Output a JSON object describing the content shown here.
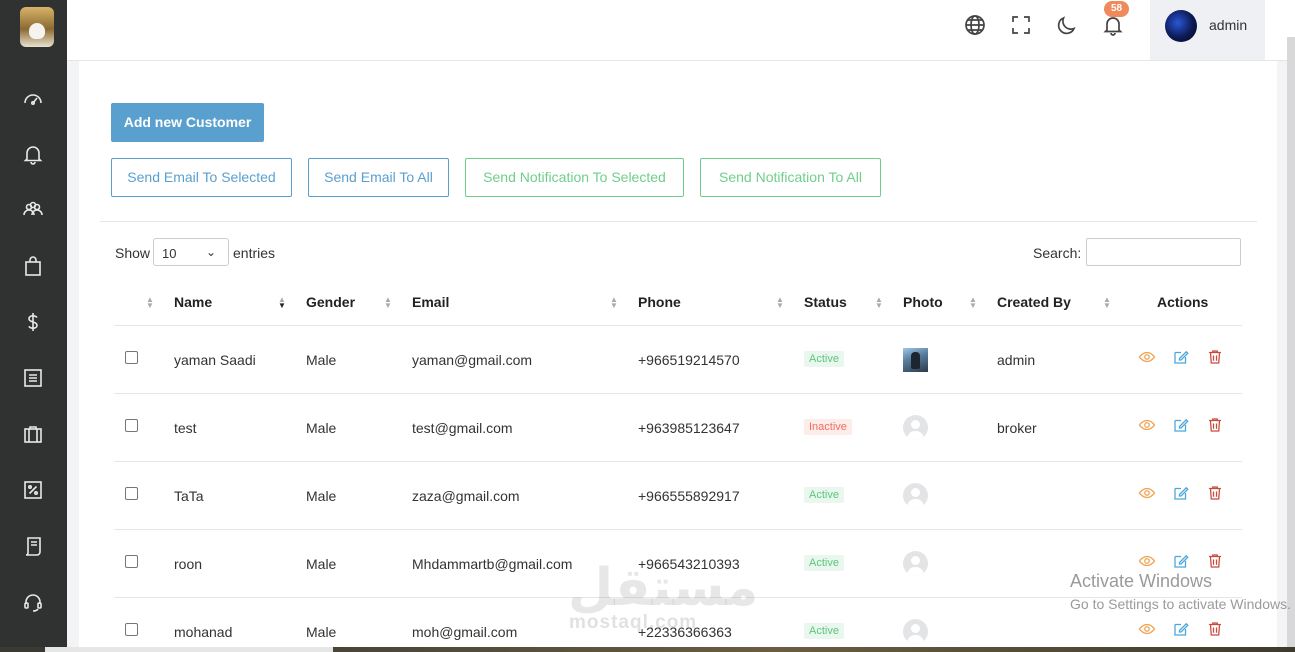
{
  "topbar": {
    "user_name": "admin",
    "notification_count": "58"
  },
  "sidebar": {
    "items": [
      {
        "icon": "dashboard-icon"
      },
      {
        "icon": "bell-icon"
      },
      {
        "icon": "users-icon"
      },
      {
        "icon": "shopping-bag-icon"
      },
      {
        "icon": "dollar-icon"
      },
      {
        "icon": "list-icon"
      },
      {
        "icon": "briefcase-icon"
      },
      {
        "icon": "percent-icon"
      },
      {
        "icon": "document-icon"
      },
      {
        "icon": "headset-icon"
      }
    ]
  },
  "actions": {
    "add_customer": "Add new Customer",
    "send_email_selected": "Send Email To Selected",
    "send_email_all": "Send Email To All",
    "send_notification_selected": "Send Notification To Selected",
    "send_notification_all": "Send Notification To All"
  },
  "table_controls": {
    "show_label": "Show",
    "page_size": "10",
    "entries_label": "entries",
    "search_label": "Search:"
  },
  "table": {
    "columns": [
      "Name",
      "Gender",
      "Email",
      "Phone",
      "Status",
      "Photo",
      "Created By",
      "Actions"
    ],
    "rows": [
      {
        "name": "yaman Saadi",
        "gender": "Male",
        "email": "yaman@gmail.com",
        "phone": "+966519214570",
        "status": "Active",
        "photo": "image",
        "created_by": "admin"
      },
      {
        "name": "test",
        "gender": "Male",
        "email": "test@gmail.com",
        "phone": "+963985123647",
        "status": "Inactive",
        "photo": "placeholder",
        "created_by": "broker"
      },
      {
        "name": "TaTa",
        "gender": "Male",
        "email": "zaza@gmail.com",
        "phone": "+966555892917",
        "status": "Active",
        "photo": "placeholder",
        "created_by": ""
      },
      {
        "name": "roon",
        "gender": "Male",
        "email": "Mhdammartb@gmail.com",
        "phone": "+966543210393",
        "status": "Active",
        "photo": "placeholder",
        "created_by": ""
      },
      {
        "name": "mohanad",
        "gender": "Male",
        "email": "moh@gmail.com",
        "phone": "+22336366363",
        "status": "Active",
        "photo": "placeholder",
        "created_by": ""
      }
    ]
  },
  "overlay": {
    "watermark_ar": "مستقل",
    "watermark_en": "mostaql.com",
    "activate_title": "Activate Windows",
    "activate_sub": "Go to Settings to activate Windows."
  },
  "colors": {
    "sidebar_bg": "#2f3230",
    "primary": "#5aa0cf",
    "green": "#6fcf8a",
    "active_text": "#5bc77b",
    "inactive_text": "#ef6f5e",
    "badge": "#f08a5d"
  }
}
